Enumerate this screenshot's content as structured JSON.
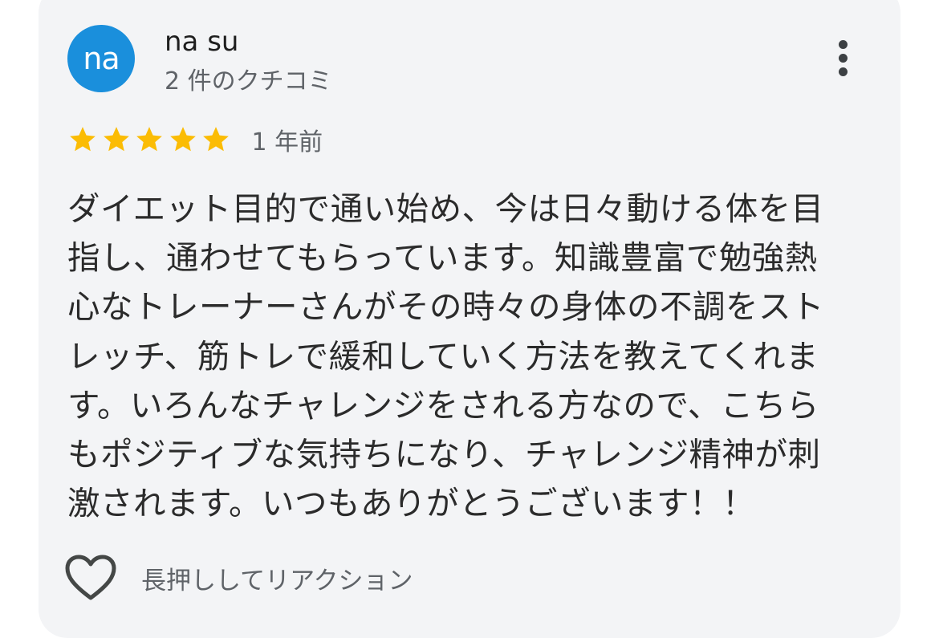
{
  "review": {
    "author": {
      "avatar_initials": "na",
      "name": "na su",
      "review_count": "2 件のクチコミ"
    },
    "rating": 5,
    "time_ago": "1 年前",
    "text_lines": [
      "ダイエット目的で通い始め、今は日々動ける体を目",
      "指し、通わせてもらっています。知識豊富で勉強熱",
      "心なトレーナーさんがその時々の身体の不調をスト",
      "レッチ、筋トレで緩和していく方法を教えてくれま",
      "す。いろんなチャレンジをされる方なので、こちら",
      "もポジティブな気持ちになり、チャレンジ精神が刺",
      "激されます。いつもありがとうございます！！"
    ],
    "reaction_label": "長押ししてリアクション"
  },
  "icons": {
    "more": "more-vertical-icon",
    "star": "star-icon",
    "reaction": "heart-outline-icon"
  },
  "colors": {
    "avatar_bg": "#1a8fdc",
    "star": "#fbbc04",
    "card_bg": "#f3f4f6"
  }
}
